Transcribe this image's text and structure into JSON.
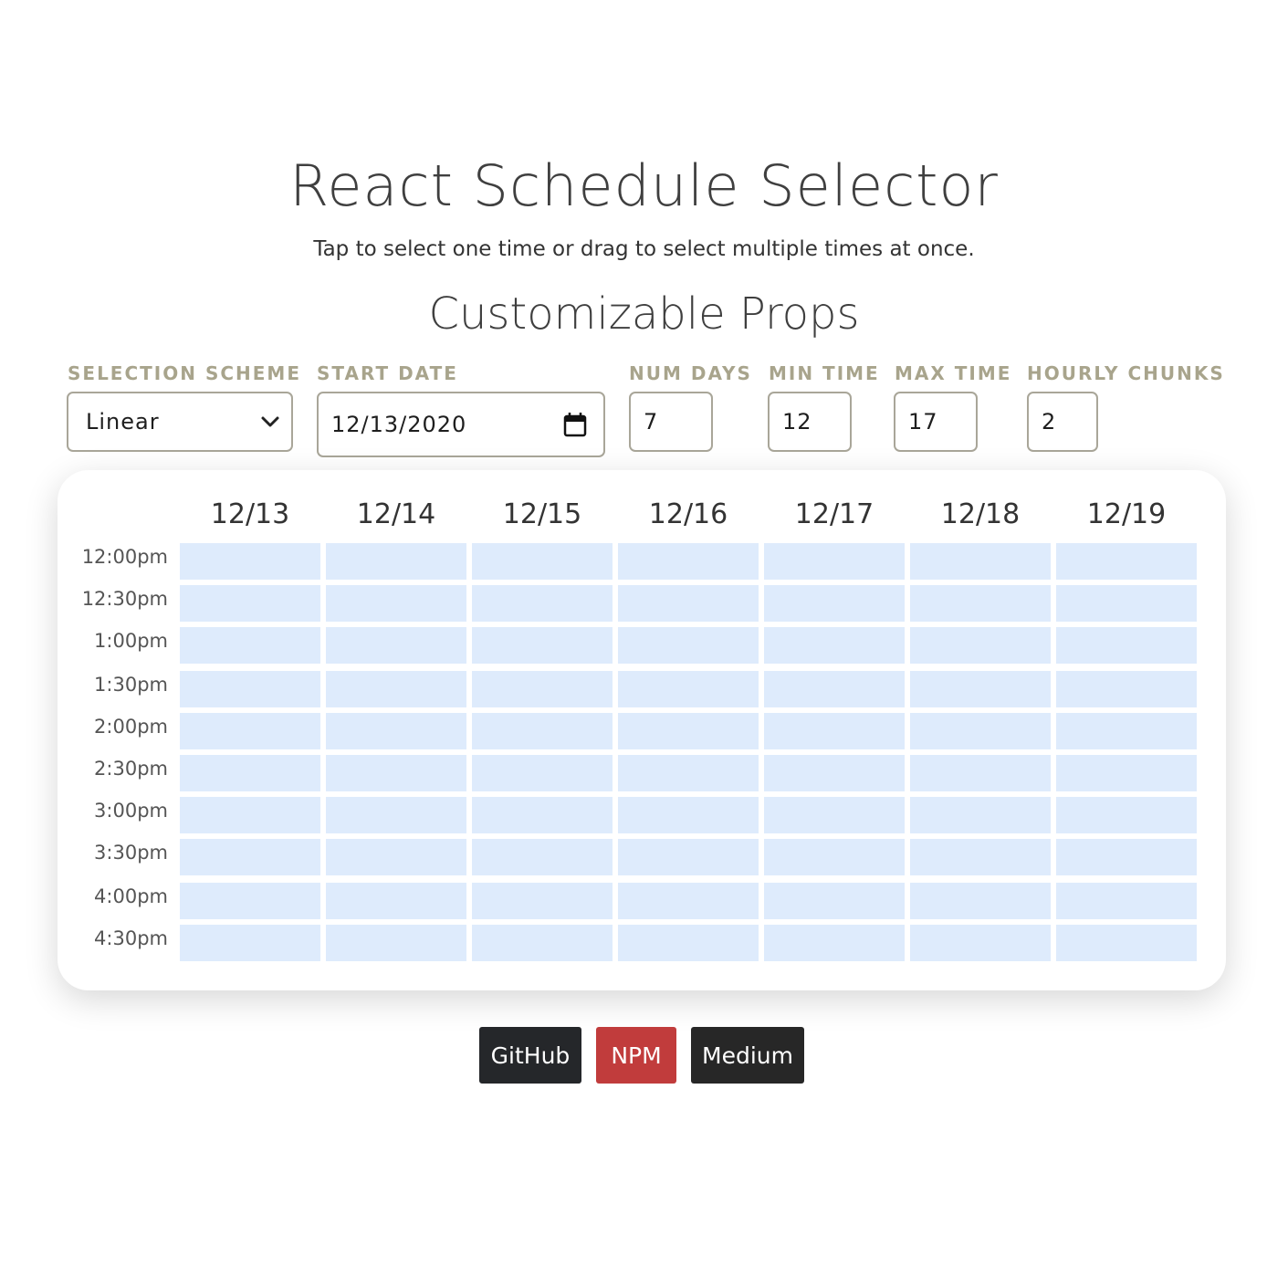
{
  "header": {
    "title": "React Schedule Selector",
    "subtitle": "Tap to select one time or drag to select multiple times at once.",
    "section_title": "Customizable Props"
  },
  "props": {
    "selection_scheme": {
      "label": "Selection Scheme",
      "value": "Linear"
    },
    "start_date": {
      "label": "Start Date",
      "value": "12/13/2020"
    },
    "num_days": {
      "label": "Num Days",
      "value": "7"
    },
    "min_time": {
      "label": "Min Time",
      "value": "12"
    },
    "max_time": {
      "label": "Max Time",
      "value": "17"
    },
    "hourly_chunks": {
      "label": "Hourly Chunks",
      "value": "2"
    }
  },
  "schedule": {
    "days": [
      "12/13",
      "12/14",
      "12/15",
      "12/16",
      "12/17",
      "12/18",
      "12/19"
    ],
    "times": [
      "12:00pm",
      "12:30pm",
      "1:00pm",
      "1:30pm",
      "2:00pm",
      "2:30pm",
      "3:00pm",
      "3:30pm",
      "4:00pm",
      "4:30pm"
    ],
    "cell_color": "#deebfc"
  },
  "links": {
    "github": {
      "label": "GitHub",
      "color": "#25272a"
    },
    "npm": {
      "label": "NPM",
      "color": "#c13c3c"
    },
    "medium": {
      "label": "Medium",
      "color": "#272727"
    }
  },
  "colors": {
    "label": "#a8a48c",
    "border": "#a9a699"
  }
}
